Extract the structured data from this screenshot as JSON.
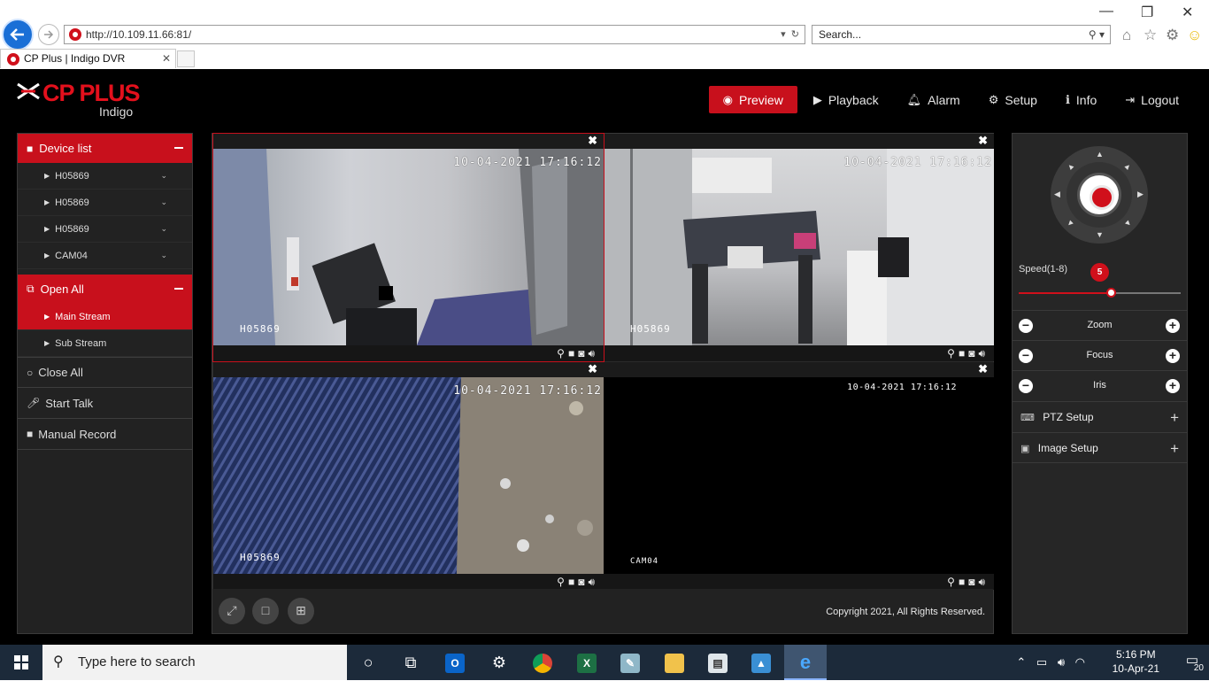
{
  "browser": {
    "url": "http://10.109.11.66:81/",
    "search_placeholder": "Search...",
    "tab_title": "CP Plus | Indigo DVR"
  },
  "app": {
    "brand": "CP PLUS",
    "brand_sub": "Indigo",
    "nav": [
      {
        "label": "Preview",
        "icon": "eye-icon",
        "active": true
      },
      {
        "label": "Playback",
        "icon": "play-icon"
      },
      {
        "label": "Alarm",
        "icon": "bell-icon"
      },
      {
        "label": "Setup",
        "icon": "gear-icon"
      },
      {
        "label": "Info",
        "icon": "info-icon"
      },
      {
        "label": "Logout",
        "icon": "logout-icon"
      }
    ]
  },
  "sidebar": {
    "device_list": "Device list",
    "devices": [
      "H05869",
      "H05869",
      "H05869",
      "CAM04"
    ],
    "open_all": "Open All",
    "main_stream": "Main Stream",
    "sub_stream": "Sub Stream",
    "close_all": "Close All",
    "start_talk": "Start Talk",
    "manual_record": "Manual Record"
  },
  "video": {
    "panes": [
      {
        "timestamp": "10-04-2021 17:16:12",
        "camera": "H05869"
      },
      {
        "timestamp": "10-04-2021 17:16:12",
        "camera": "H05869"
      },
      {
        "timestamp": "10-04-2021 17:16:12",
        "camera": "H05869"
      },
      {
        "timestamp": "10-04-2021 17:16:12",
        "camera": "CAM04"
      }
    ],
    "copyright": "Copyright 2021, All Rights Reserved."
  },
  "ptz": {
    "speed_label": "Speed(1-8)",
    "speed_value": "5",
    "speed_fraction": 0.57,
    "zoom": "Zoom",
    "focus": "Focus",
    "iris": "Iris",
    "ptz_setup": "PTZ Setup",
    "image_setup": "Image Setup"
  },
  "taskbar": {
    "search_placeholder": "Type here to search",
    "time": "5:16 PM",
    "date": "10-Apr-21",
    "notifications": "20"
  }
}
